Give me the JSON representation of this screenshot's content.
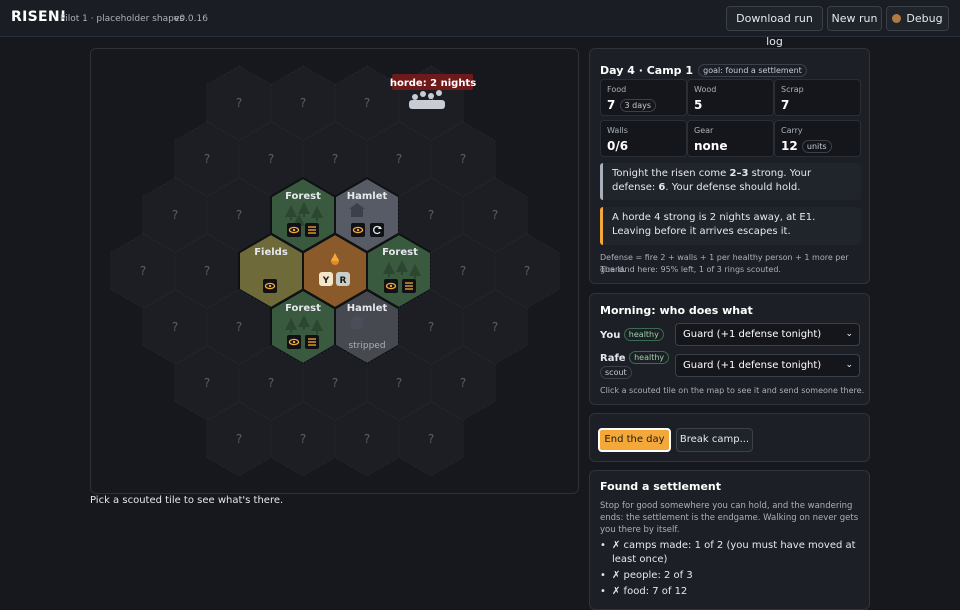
{
  "header": {
    "title": "RISEN!",
    "subtitle": "Pilot 1 · placeholder shapes",
    "version": "v0.0.16",
    "buttons": {
      "download": "Download run log",
      "new_run": "New run",
      "debug": "Debug"
    }
  },
  "map": {
    "horde_label": "horde: 2 nights",
    "unknown": "?",
    "tiles": {
      "forest_n": "Forest",
      "hamlet_ne": "Hamlet",
      "fields": "Fields",
      "forest_e": "Forest",
      "forest_s": "Forest",
      "hamlet_se": "Hamlet",
      "stripped": "stripped"
    },
    "camp_people": [
      "Y",
      "R"
    ]
  },
  "hint": "Pick a scouted tile to see what's there.",
  "status": {
    "title": "Day 4 · Camp 1",
    "goal": "goal: found a settlement",
    "stats": [
      {
        "label": "Food",
        "value": "7",
        "chip": "3 days"
      },
      {
        "label": "Wood",
        "value": "5"
      },
      {
        "label": "Scrap",
        "value": "7"
      },
      {
        "label": "Walls",
        "value": "0/6"
      },
      {
        "label": "Gear",
        "value": "none"
      },
      {
        "label": "Carry",
        "value": "12",
        "chip": "units"
      }
    ],
    "note1_a": "Tonight the risen come ",
    "note1_b": "2–3",
    "note1_c": " strong. Your defense: ",
    "note1_d": "6",
    "note1_e": ". Your defense should hold.",
    "note2": "A horde 4 strong is 2 nights away, at E1. Leaving before it arrives escapes it.",
    "defense": "Defense = fire 2 + walls + 1 per healthy person + 1 more per guard.",
    "land": "The land here: 95% left, 1 of 3 rings scouted."
  },
  "morning": {
    "title": "Morning: who does what",
    "people": [
      {
        "name": "You",
        "status": "healthy",
        "task": "Guard (+1 defense tonight)"
      },
      {
        "name": "Rafe",
        "status": "healthy",
        "role": "scout",
        "task": "Guard (+1 defense tonight)"
      }
    ],
    "hint": "Click a scouted tile on the map to see it and send someone there."
  },
  "actions": {
    "end_day": "End the day",
    "break_camp": "Break camp..."
  },
  "goal_panel": {
    "title": "Found a settlement",
    "desc": "Stop for good somewhere you can hold, and the wandering ends: the settlement is the endgame. Walking on never gets you there by itself.",
    "items": [
      "✗ camps made: 1 of 2 (you must have moved at least once)",
      "✗ people: 2 of 3",
      "✗ food: 7 of 12"
    ]
  },
  "colors": {
    "accent": "#f5a83a",
    "forest": "#3a5a40",
    "hamlet": "#575b66",
    "fields": "#6f6a3a",
    "camp": "#8a5a2a"
  }
}
